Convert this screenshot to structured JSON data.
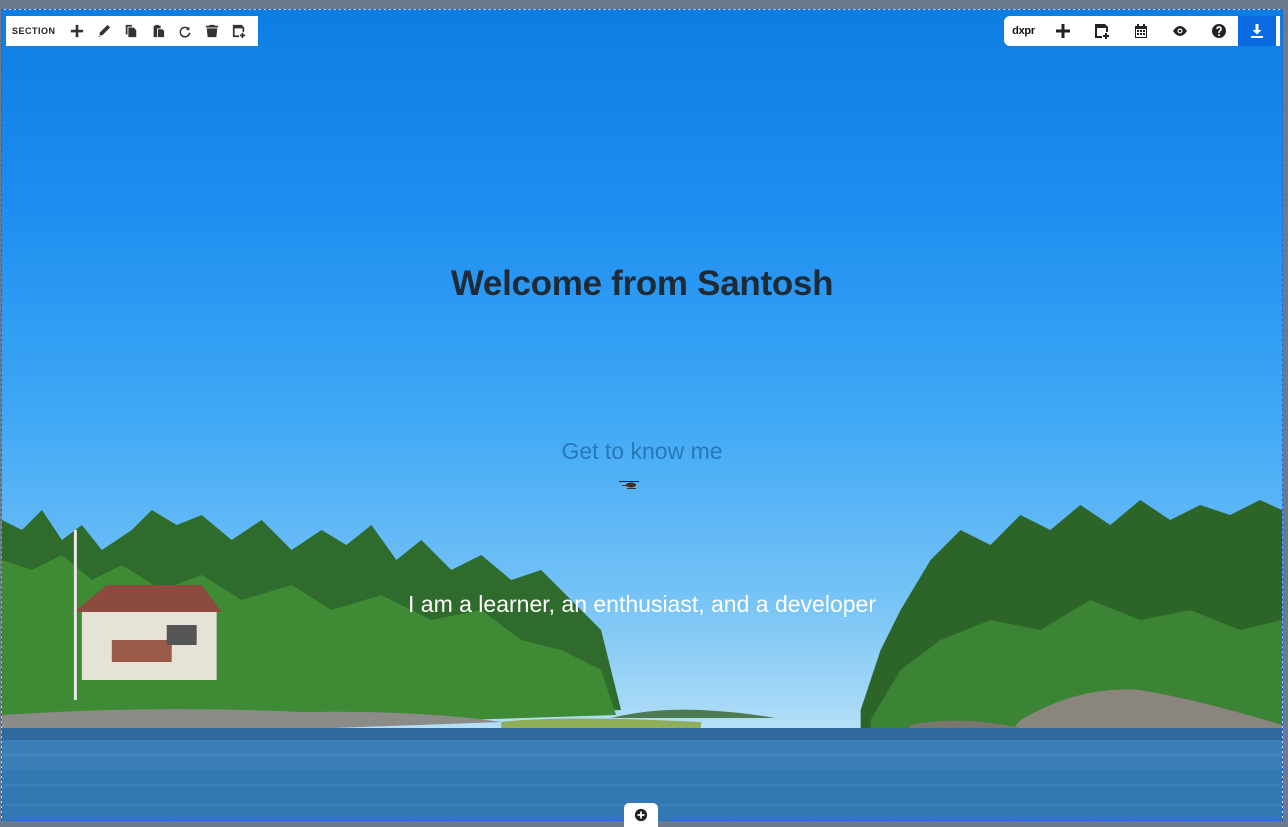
{
  "hero": {
    "title": "Welcome from Santosh",
    "cta_label": "Get to know me",
    "tagline": "I am a learner, an enthusiast, and a developer"
  },
  "section_toolbar": {
    "label": "SECTION",
    "buttons": [
      "plus-icon",
      "pencil-icon",
      "copy-icon",
      "paste-icon",
      "refresh-icon",
      "trash-icon",
      "save-icon"
    ]
  },
  "editor_toolbar": {
    "brand": "dxpr",
    "buttons": [
      "plus-icon",
      "save-icon",
      "calendar-icon",
      "eye-icon",
      "help-icon",
      "download-icon"
    ]
  },
  "colors": {
    "accent": "#0a6be0",
    "selection_border": "#2a62d6"
  }
}
